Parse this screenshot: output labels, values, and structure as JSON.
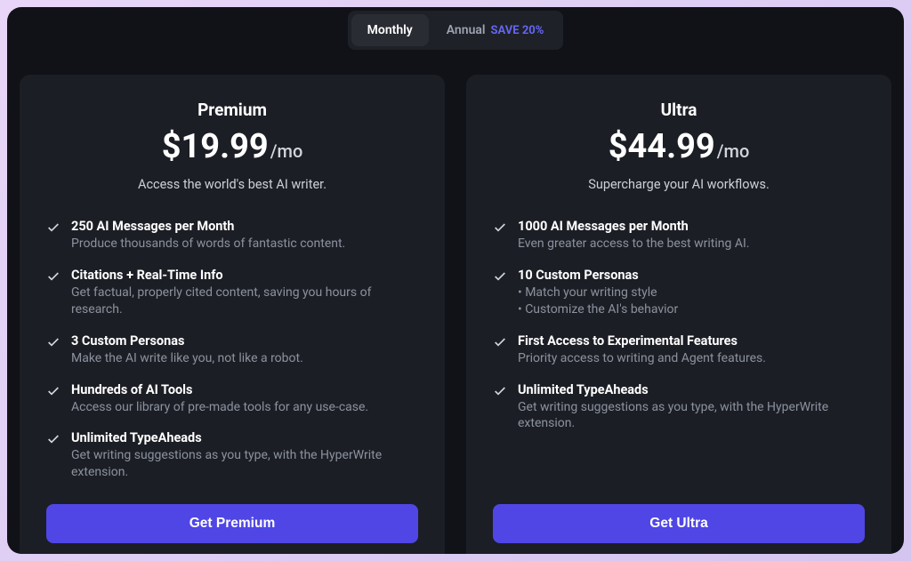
{
  "toggle": {
    "monthly": "Monthly",
    "annual": "Annual",
    "save": "SAVE 20%"
  },
  "plans": {
    "premium": {
      "name": "Premium",
      "price": "$19.99",
      "period": "/mo",
      "tagline": "Access the world's best AI writer.",
      "cta": "Get Premium",
      "features": [
        {
          "title": "250 AI Messages per Month",
          "desc": "Produce thousands of words of fantastic content."
        },
        {
          "title": "Citations + Real-Time Info",
          "desc": "Get factual, properly cited content, saving you hours of research."
        },
        {
          "title": "3 Custom Personas",
          "desc": "Make the AI write like you, not like a robot."
        },
        {
          "title": "Hundreds of AI Tools",
          "desc": "Access our library of pre-made tools for any use-case."
        },
        {
          "title": "Unlimited TypeAheads",
          "desc": "Get writing suggestions as you type, with the HyperWrite extension."
        }
      ]
    },
    "ultra": {
      "name": "Ultra",
      "price": "$44.99",
      "period": "/mo",
      "tagline": "Supercharge your AI workflows.",
      "cta": "Get Ultra",
      "features": [
        {
          "title": "1000 AI Messages per Month",
          "desc": "Even greater access to the best writing AI."
        },
        {
          "title": "10 Custom Personas",
          "bullets": [
            "• Match your writing style",
            "• Customize the AI's behavior"
          ]
        },
        {
          "title": "First Access to Experimental Features",
          "desc": "Priority access to writing and Agent features."
        },
        {
          "title": "Unlimited TypeAheads",
          "desc": "Get writing suggestions as you type, with the HyperWrite extension."
        }
      ]
    }
  }
}
